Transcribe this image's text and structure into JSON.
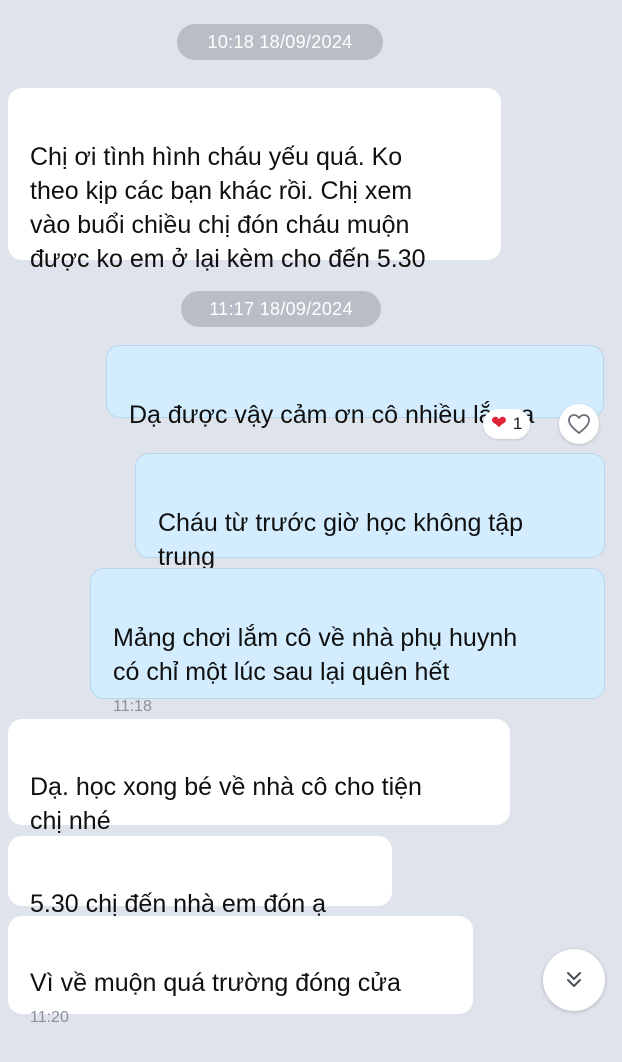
{
  "chat": {
    "timestamps": [
      "10:18 18/09/2024",
      "11:17 18/09/2024"
    ],
    "messages": [
      {
        "dir": "in",
        "text": "Chị ơi tình hình cháu yếu quá. Ko\ntheo kịp các bạn khác rồi. Chị xem\nvào buổi chiều chị đón cháu muộn\nđược ko em ở lại kèm cho đến 5.30",
        "time": ""
      },
      {
        "dir": "out",
        "text": "Dạ được vậy cảm ơn cô nhiều lắm ạ",
        "time": ""
      },
      {
        "dir": "out",
        "text": "Cháu từ trước giờ học không tập\ntrung",
        "time": ""
      },
      {
        "dir": "out",
        "text": "Mảng chơi lắm cô về nhà phụ huynh\ncó chỉ một lúc sau lại quên hết",
        "time": "11:18"
      },
      {
        "dir": "in",
        "text": "Dạ. học xong bé về nhà cô cho tiện\nchị nhé",
        "time": ""
      },
      {
        "dir": "in",
        "text": "5.30 chị đến nhà em đón ạ",
        "time": ""
      },
      {
        "dir": "in",
        "text": "Vì về muộn quá trường đóng cửa",
        "time": "11:20"
      }
    ],
    "reaction": {
      "emoji": "❤",
      "count": "1"
    },
    "icons": {
      "heart_outline": "heart-outline-icon",
      "scroll_down": "double-chevron-down-icon"
    },
    "colors": {
      "background": "#dfe3eb",
      "incoming": "#ffffff",
      "outgoing": "#d3edff",
      "timestamp_pill": "#b8bdc6",
      "reaction_heart": "#e0243a"
    }
  }
}
